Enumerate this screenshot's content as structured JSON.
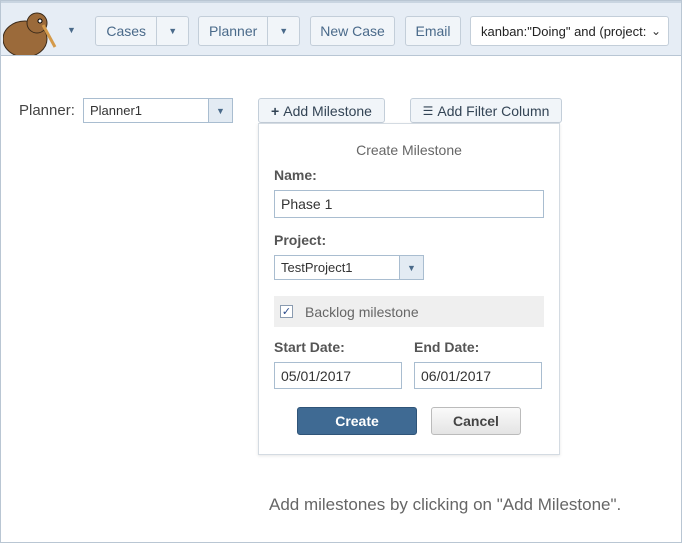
{
  "header": {
    "cases": "Cases",
    "planner": "Planner",
    "new_case": "New Case",
    "email": "Email",
    "search": "kanban:\"Doing\" and (project:"
  },
  "toolbar": {
    "planner_label": "Planner:",
    "planner_value": "Planner1",
    "add_milestone": "Add Milestone",
    "add_filter_column": "Add Filter Column"
  },
  "dialog": {
    "title": "Create Milestone",
    "name_label": "Name:",
    "name_value": "Phase 1",
    "project_label": "Project:",
    "project_value": "TestProject1",
    "backlog_label": "Backlog milestone",
    "backlog_checked": true,
    "start_label": "Start Date:",
    "start_value": "05/01/2017",
    "end_label": "End Date:",
    "end_value": "06/01/2017",
    "create": "Create",
    "cancel": "Cancel"
  },
  "hint": "Add milestones by clicking on \"Add Milestone\"."
}
